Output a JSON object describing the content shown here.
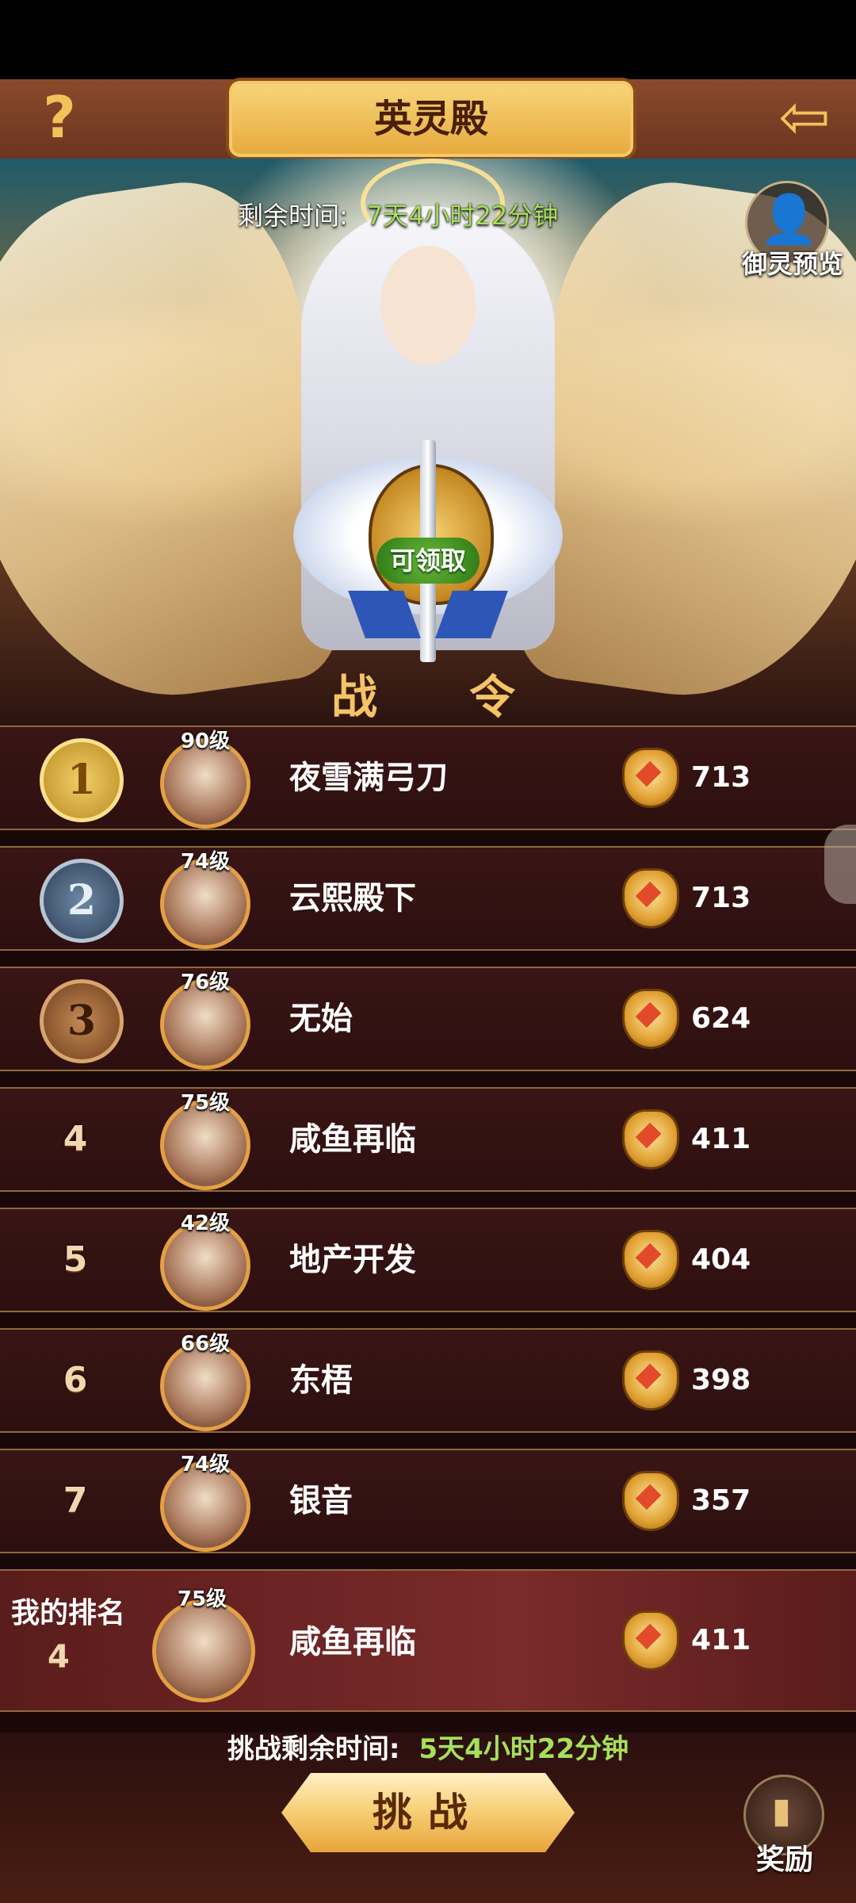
{
  "header": {
    "title": "英灵殿",
    "help_icon": "?",
    "back_icon": "⇦"
  },
  "hero": {
    "remaining_label": "剩余时间:",
    "remaining_value": "7天4小时22分钟",
    "preview_label": "御灵预览",
    "preview_icon": "person-icon",
    "claim_badge": "可领取",
    "emblem_caption_left": "战",
    "emblem_caption_right": "令"
  },
  "ranking": [
    {
      "rank": "1",
      "level": "90级",
      "name": "夜雪满弓刀",
      "score": "713",
      "medal": "gold"
    },
    {
      "rank": "2",
      "level": "74级",
      "name": "云熙殿下",
      "score": "713",
      "medal": "silver"
    },
    {
      "rank": "3",
      "level": "76级",
      "name": "无始",
      "score": "624",
      "medal": "bronze"
    },
    {
      "rank": "4",
      "level": "75级",
      "name": "咸鱼再临",
      "score": "411"
    },
    {
      "rank": "5",
      "level": "42级",
      "name": "地产开发",
      "score": "404"
    },
    {
      "rank": "6",
      "level": "66级",
      "name": "东梧",
      "score": "398"
    },
    {
      "rank": "7",
      "level": "74级",
      "name": "银音",
      "score": "357"
    }
  ],
  "my_rank": {
    "label": "我的排名",
    "rank": "4",
    "level": "75级",
    "name": "咸鱼再临",
    "score": "411"
  },
  "footer": {
    "challenge_time_label": "挑战剩余时间:",
    "challenge_time_value": "5天4小时22分钟",
    "challenge_button": "挑战",
    "reward_label": "奖励",
    "reward_icon": "▮"
  },
  "colors": {
    "accent_gold": "#f3c468",
    "time_green": "#a6e05a",
    "row_bg": "#3a1515"
  }
}
